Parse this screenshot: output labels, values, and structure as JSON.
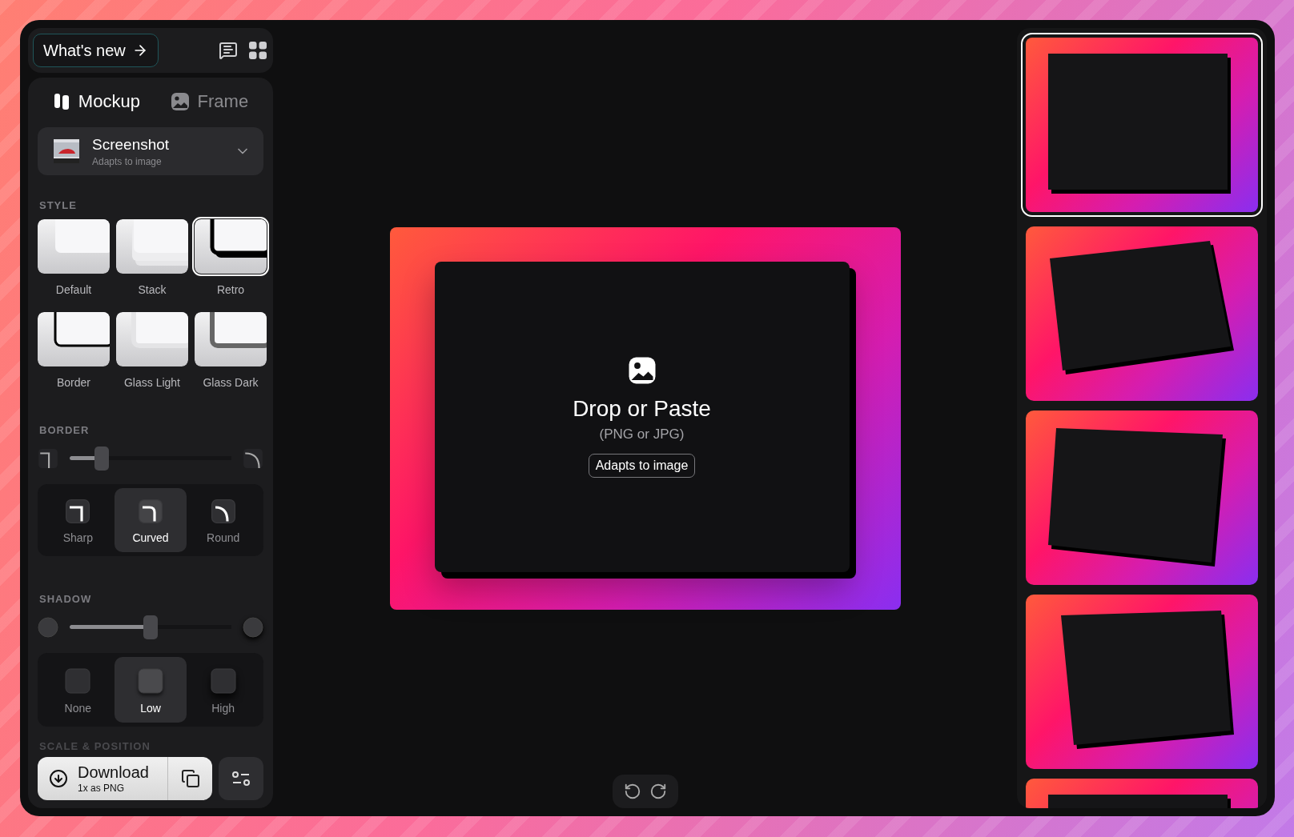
{
  "header": {
    "whats_new": "What's new"
  },
  "mode_tabs": [
    {
      "label": "Mockup",
      "kind": "mockup",
      "selected": true
    },
    {
      "label": "Frame",
      "kind": "frame",
      "selected": false
    }
  ],
  "device_select": {
    "title": "Screenshot",
    "subtitle": "Adapts to image"
  },
  "style": {
    "heading": "STYLE",
    "options": [
      {
        "label": "Default",
        "kind": "default",
        "selected": false
      },
      {
        "label": "Stack",
        "kind": "stack",
        "selected": false
      },
      {
        "label": "Retro",
        "kind": "retro",
        "selected": true
      },
      {
        "label": "Border",
        "kind": "border",
        "selected": false
      },
      {
        "label": "Glass Light",
        "kind": "glass-light",
        "selected": false
      },
      {
        "label": "Glass Dark",
        "kind": "glass-dark",
        "selected": false
      }
    ]
  },
  "border": {
    "heading": "BORDER",
    "level": 0.2,
    "options": [
      {
        "label": "Sharp",
        "kind": "sharp",
        "selected": false
      },
      {
        "label": "Curved",
        "kind": "curved",
        "selected": true
      },
      {
        "label": "Round",
        "kind": "round",
        "selected": false
      }
    ]
  },
  "shadow": {
    "heading": "SHADOW",
    "level": 0.5,
    "options": [
      {
        "label": "None",
        "kind": "none",
        "selected": false
      },
      {
        "label": "Low",
        "kind": "low",
        "selected": true
      },
      {
        "label": "High",
        "kind": "high",
        "selected": false
      }
    ]
  },
  "next_section": {
    "heading": "SCALE & POSITION"
  },
  "download": {
    "title": "Download",
    "subtitle": "1x as PNG"
  },
  "canvas": {
    "title": "Drop or Paste",
    "hint": "(PNG or JPG)",
    "badge": "Adapts to image"
  },
  "thumbnails": [
    {
      "kind": "flat",
      "selected": true
    },
    {
      "kind": "tilt-right",
      "selected": false
    },
    {
      "kind": "tilt-left",
      "selected": false
    },
    {
      "kind": "tilt-back",
      "selected": false
    },
    {
      "kind": "flat",
      "selected": false
    }
  ]
}
